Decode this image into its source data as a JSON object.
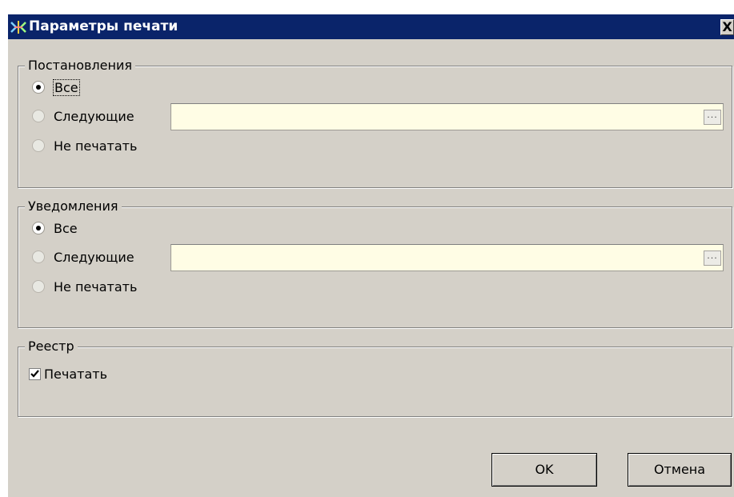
{
  "window": {
    "title": "Параметры печати",
    "close_glyph": "X",
    "icon": "app-icon"
  },
  "resolutions": {
    "legend": "Постановления",
    "options": [
      "Все",
      "Следующие",
      "Не печатать"
    ],
    "selected": "Все",
    "field_value": "",
    "browse_label": "..."
  },
  "notifications": {
    "legend": "Уведомления",
    "options": [
      "Все",
      "Следующие",
      "Не печатать"
    ],
    "selected": "Все",
    "field_value": "",
    "browse_label": "..."
  },
  "registry": {
    "legend": "Реестр",
    "print_label": "Печатать",
    "print_checked": true
  },
  "buttons": {
    "ok": "OK",
    "cancel": "Отмена"
  },
  "colors": {
    "titlebar": "#0a246a",
    "dialog_bg": "#d4d0c8",
    "field_bg": "#fffde5"
  }
}
